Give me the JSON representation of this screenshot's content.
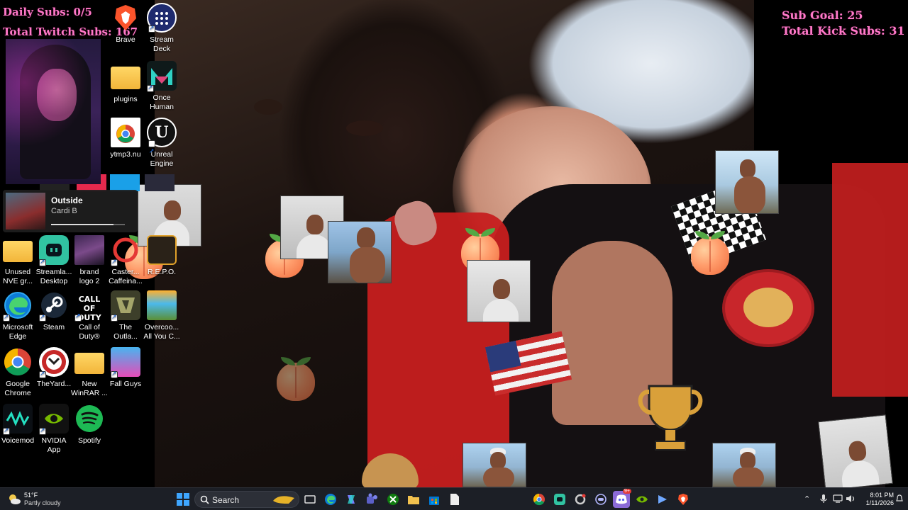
{
  "overlay": {
    "daily_subs": "Daily Subs: 0/5",
    "total_twitch": "Total Twitch Subs: 167",
    "sub_goal": "Sub Goal: 25",
    "total_kick": "Total Kick Subs: 31"
  },
  "desktop_icons": {
    "brave": "Brave",
    "stream_deck": "Stream\nDeck",
    "plugins": "plugins",
    "once_human": "Once\nHuman",
    "ytmp3": "ytmp3.nu",
    "unreal_engine": "Unreal\nEngine",
    "unused_nve": "Unused\nNVE gr...",
    "streamlabs": "Streamla...\nDesktop",
    "brand_logo": "brand\nlogo 2",
    "caster": "Caster...\nCaffeina...",
    "repo": "R.E.P.O.",
    "edge": "Microsoft\nEdge",
    "steam": "Steam",
    "cod": "Call of\nDuty®",
    "outlast": "The\nOutla...",
    "overcooked": "Overcoo...\nAll You C...",
    "chrome": "Google\nChrome",
    "theyard": "TheYard...",
    "winrar": "New\nWinRAR ...",
    "fallguys": "Fall Guys",
    "voicemod": "Voicemod",
    "nvidia": "NVIDIA\nApp",
    "spotify": "Spotify",
    "cod_icon_text": "CALL OF DUTY",
    "ue_icon_text": "U"
  },
  "media": {
    "title": "Outside",
    "artist": "Cardi B",
    "progress": 0.85
  },
  "taskbar": {
    "temperature": "51°F",
    "condition": "Partly cloudy",
    "search_label": "Search",
    "time": "8:01 PM",
    "date": "1/11/2026",
    "discord_badge": "9+"
  }
}
